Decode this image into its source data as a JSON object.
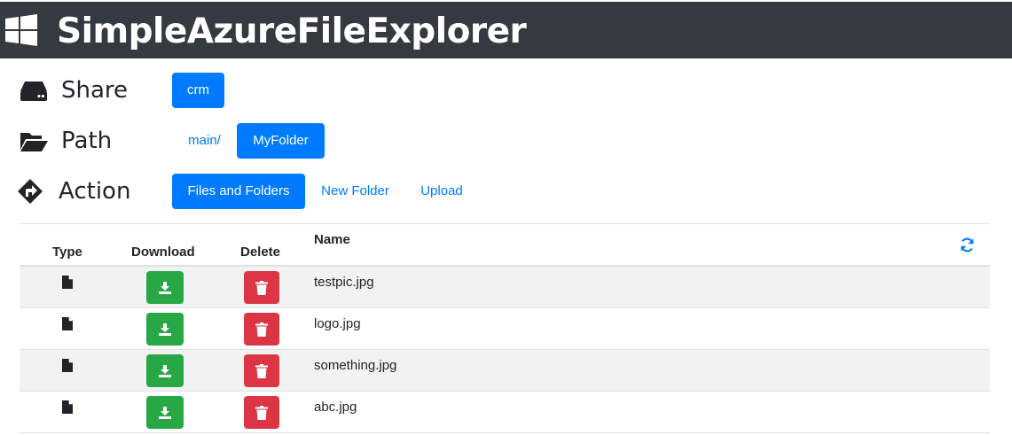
{
  "app": {
    "title": "SimpleAzureFileExplorer",
    "logo_icon": "windows-icon"
  },
  "share": {
    "label": "Share",
    "icon": "hdd-icon",
    "items": [
      "crm"
    ]
  },
  "path": {
    "label": "Path",
    "icon": "folder-open-icon",
    "root": "main/",
    "current": "MyFolder"
  },
  "action": {
    "label": "Action",
    "icon": "directions-icon",
    "buttons": [
      "Files and Folders",
      "New Folder",
      "Upload"
    ]
  },
  "table": {
    "headers": {
      "type": "Type",
      "download": "Download",
      "delete": "Delete",
      "name": "Name"
    },
    "rows": [
      {
        "name": "testpic.jpg"
      },
      {
        "name": "logo.jpg"
      },
      {
        "name": "something.jpg"
      },
      {
        "name": "abc.jpg"
      }
    ]
  },
  "colors": {
    "header_bg": "#343a40",
    "primary": "#007bff",
    "success": "#28a745",
    "danger": "#dc3545",
    "stripe": "#f2f2f2"
  }
}
